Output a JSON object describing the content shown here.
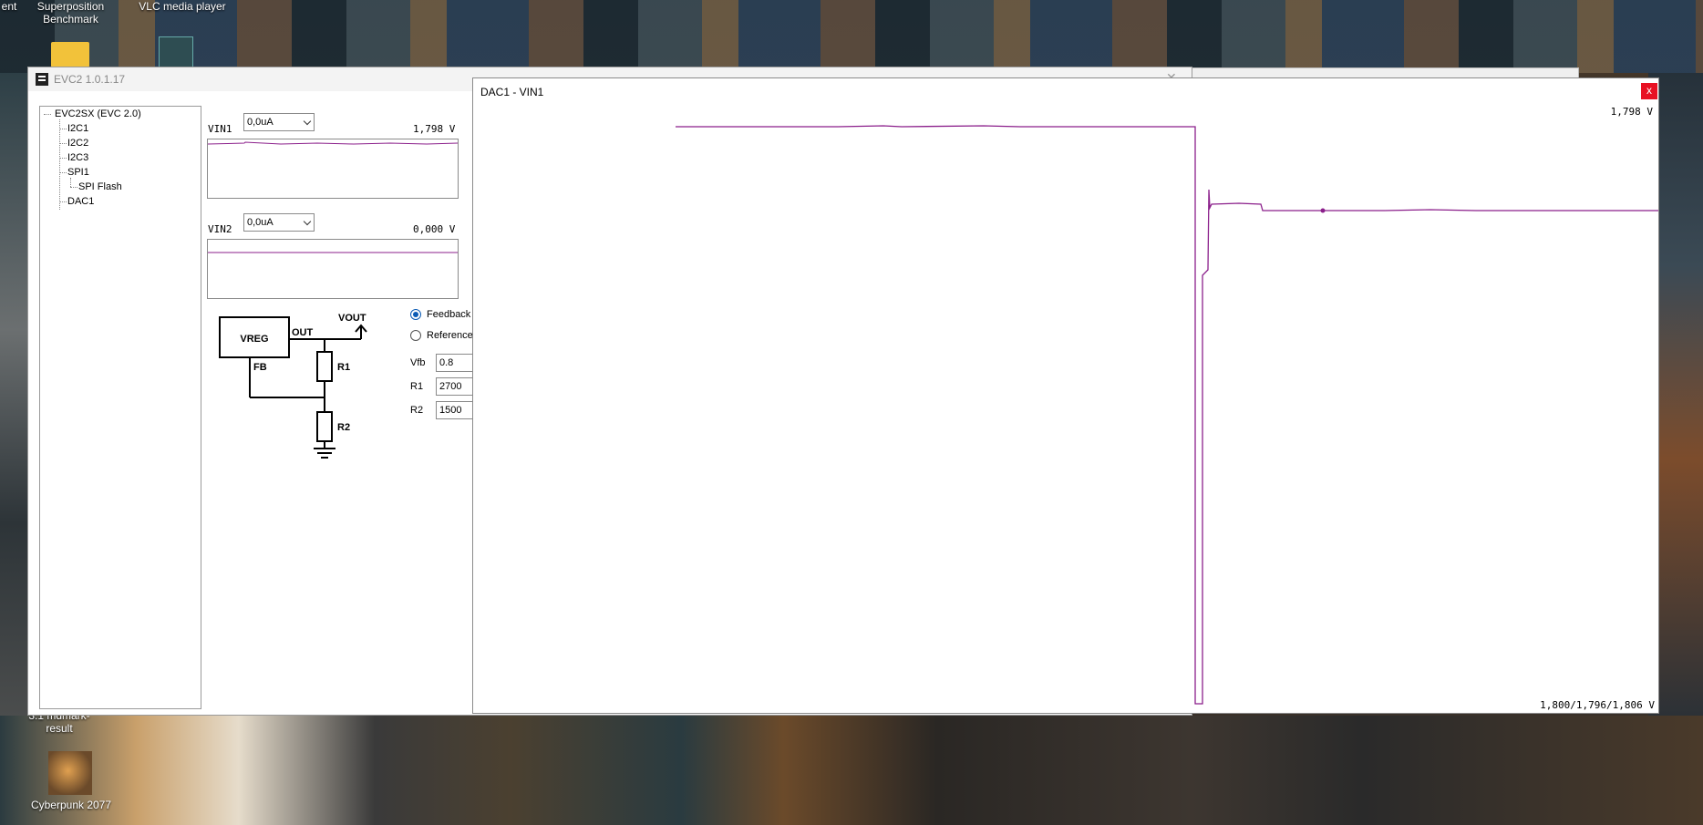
{
  "desktop": {
    "icon_labels": [
      "ent",
      "Superposition\nBenchmark",
      "VLC media player",
      "Cyberpunk 2077",
      "3.1 mdmark-result"
    ]
  },
  "evc_window": {
    "title": "EVC2 1.0.1.17",
    "tree": {
      "root": "EVC2SX (EVC 2.0)",
      "items": [
        "I2C1",
        "I2C2",
        "I2C3",
        "SPI1",
        "SPI Flash",
        "DAC1"
      ]
    },
    "vin1": {
      "label": "VIN1",
      "current": "0,0uA",
      "voltage": "1,798 V"
    },
    "vin2": {
      "label": "VIN2",
      "current": "0,0uA",
      "voltage": "0,000 V"
    },
    "schematic": {
      "vreg": "VREG",
      "out": "OUT",
      "fb": "FB",
      "vout": "VOUT",
      "r1": "R1",
      "r2": "R2"
    },
    "mode_options": [
      {
        "label": "Feedback",
        "selected": true
      },
      {
        "label": "Reference",
        "selected": false
      }
    ],
    "fields": [
      {
        "label": "Vfb",
        "value": "0.8"
      },
      {
        "label": "R1",
        "value": "2700"
      },
      {
        "label": "R2",
        "value": "1500"
      }
    ]
  },
  "dac_window": {
    "title": "DAC1 - VIN1",
    "close_label": "x",
    "top_readout": "1,798 V",
    "bottom_readout": "1,800/1,796/1,806 V",
    "trace_color": "#8b1f8b"
  }
}
